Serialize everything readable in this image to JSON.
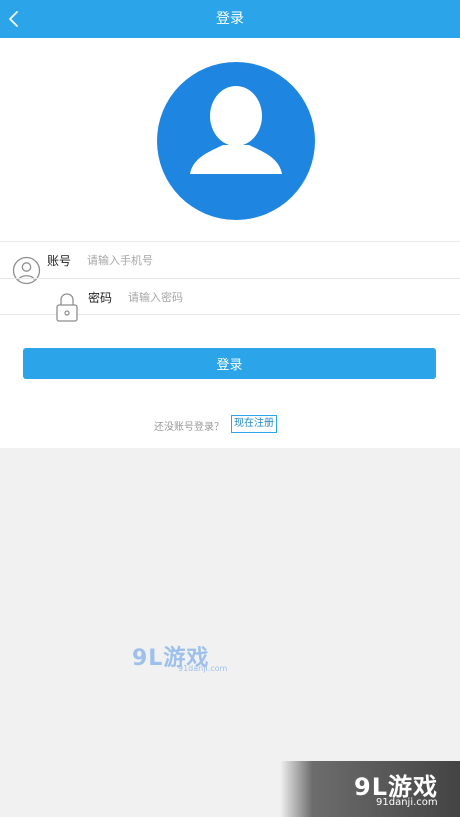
{
  "header": {
    "title": "登录",
    "background": "#2ba4ea",
    "back_icon": "chevron-left-icon"
  },
  "avatar": {
    "icon": "user-silhouette-icon",
    "color": "#1e86e0"
  },
  "form": {
    "account_label": "账号",
    "account_placeholder": "请输入手机号",
    "account_icon": "user-icon",
    "password_label": "密码",
    "password_placeholder": "请输入密码",
    "password_icon": "lock-icon"
  },
  "login_button": {
    "label": "登录"
  },
  "register": {
    "hint": "还没账号登录？",
    "link": "现在注册"
  },
  "watermark": {
    "brand": "9L游戏",
    "site": "91danji.com"
  }
}
